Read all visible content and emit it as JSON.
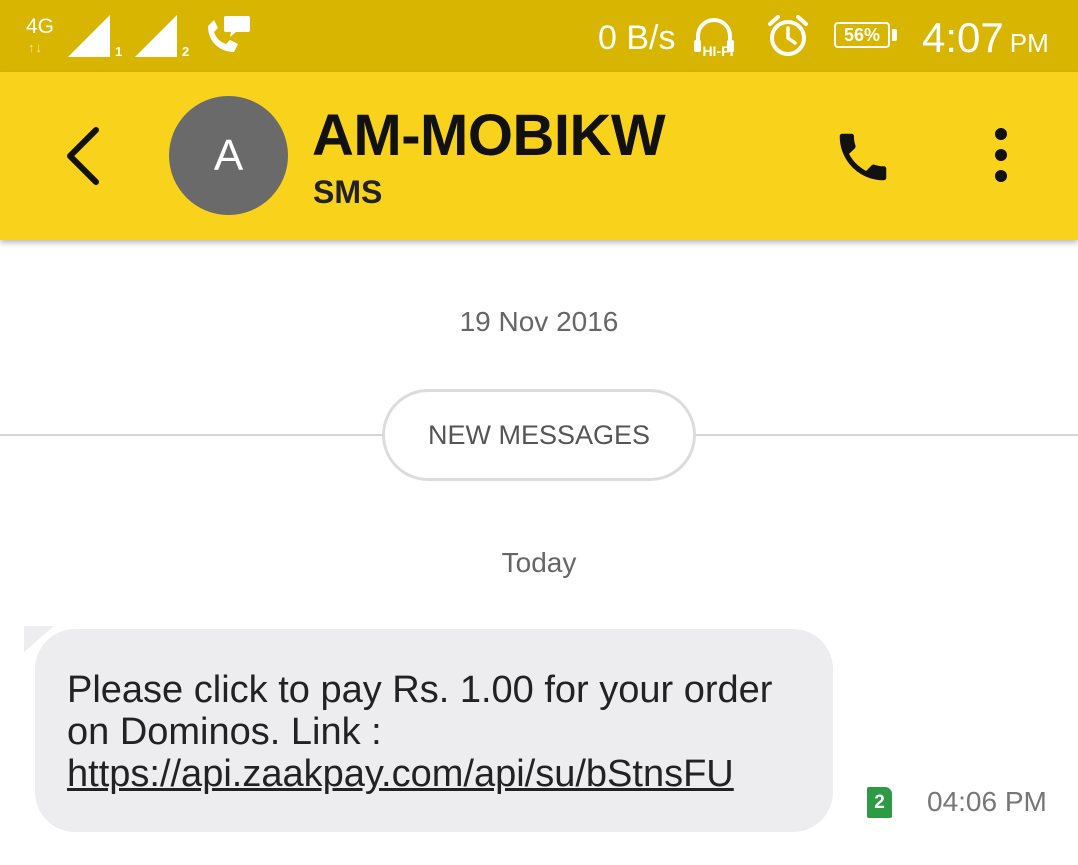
{
  "status_bar": {
    "network_type": "4G",
    "network_arrows": "↑↓",
    "sim1_label": "1",
    "sim2_label": "2",
    "data_speed": "0 B/s",
    "hifi_label": "HI-FI",
    "battery_level": "56%",
    "time": "4:07",
    "time_ampm": "PM",
    "icons": [
      "signal-icon",
      "call-forward-icon",
      "headphones-icon",
      "alarm-icon",
      "battery-icon"
    ]
  },
  "toolbar": {
    "avatar_letter": "A",
    "contact_name": "AM-MOBIKW",
    "contact_sub": "SMS",
    "icons": [
      "back-arrow-icon",
      "phone-icon",
      "more-vert-icon"
    ],
    "background_color": "#f9d21b"
  },
  "conversation": {
    "date_label": "19 Nov 2016",
    "new_messages_label": "NEW MESSAGES",
    "today_label": "Today",
    "message": {
      "text_before_link": "Please click to pay Rs. 1.00 for your order on Dominos. Link : ",
      "link_text": "https://api.zaakpay.com/api/su/bStnsFU",
      "sim_badge": "2",
      "time": "04:06 PM",
      "sim_badge_color": "#2e9a43"
    }
  }
}
